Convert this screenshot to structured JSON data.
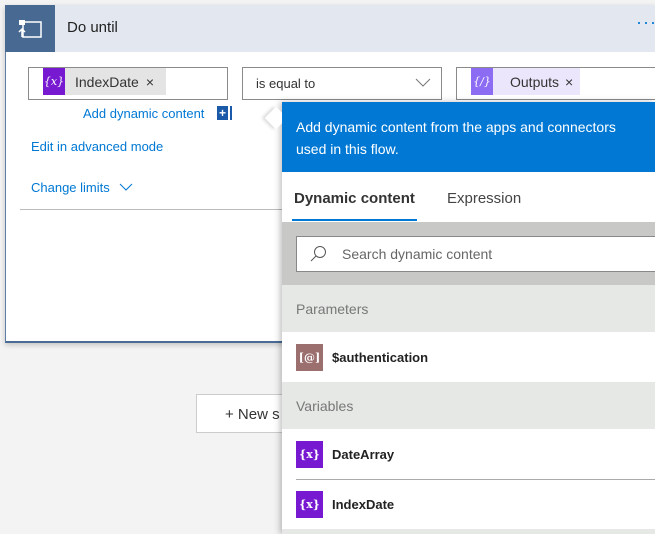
{
  "card": {
    "title": "Do until",
    "more": "···"
  },
  "condition": {
    "left_token": "IndexDate",
    "operator": "is equal to",
    "right_token": "Outputs",
    "remove": "×"
  },
  "links": {
    "add_dynamic": "Add dynamic content",
    "add_plus": "+",
    "advanced": "Edit in advanced mode",
    "change_limits": "Change limits"
  },
  "new_step": "+ New s",
  "panel": {
    "header": "Add dynamic content from the apps and connectors used in this flow.",
    "tabs": [
      "Dynamic content",
      "Expression"
    ],
    "search_placeholder": "Search dynamic content",
    "sections": [
      {
        "label": "Parameters",
        "items": [
          {
            "label": "$authentication",
            "icon": "[@]"
          }
        ]
      },
      {
        "label": "Variables",
        "items": [
          {
            "label": "DateArray",
            "icon": "{x}"
          },
          {
            "label": "IndexDate",
            "icon": "{x}"
          }
        ]
      }
    ]
  },
  "colors": {
    "accent": "#0078d4",
    "variable": "#7719d1",
    "parameter": "#9c6f6f",
    "header": "#486991"
  }
}
